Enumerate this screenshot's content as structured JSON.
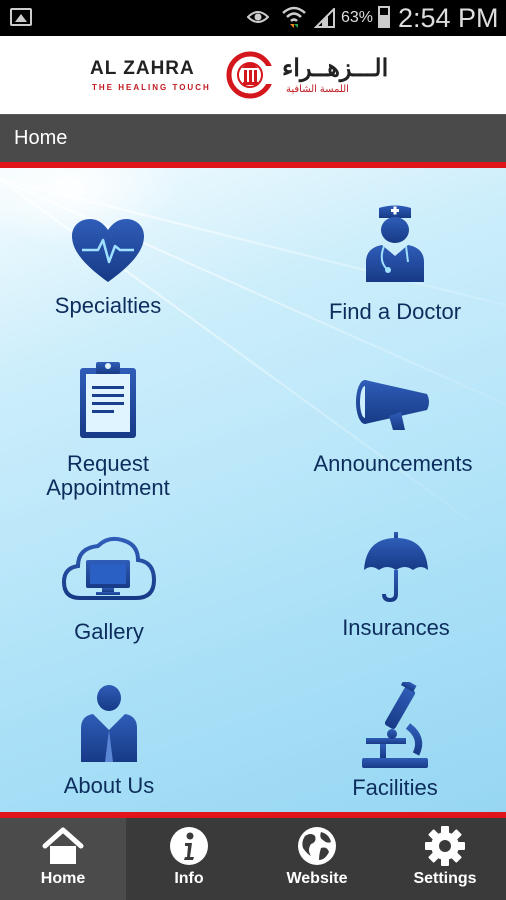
{
  "status_bar": {
    "battery_percent": "63%",
    "time": "2:54 PM"
  },
  "header": {
    "logo_name": "AL ZAHRA",
    "logo_tagline": "THE HEALING TOUCH",
    "logo_name_arabic": "الـــزهــراء",
    "logo_tagline_arabic": "اللمسة الشافية"
  },
  "titlebar": {
    "title": "Home"
  },
  "menu": {
    "specialties": "Specialties",
    "find_doctor": "Find a Doctor",
    "request_line1": "Request",
    "request_line2": "Appointment",
    "announcements": "Announcements",
    "gallery": "Gallery",
    "insurances": "Insurances",
    "about_us": "About Us",
    "facilities": "Facilities"
  },
  "tabs": {
    "home": "Home",
    "info": "Info",
    "website": "Website",
    "settings": "Settings",
    "active": "home"
  },
  "colors": {
    "accent_red": "#e0141b",
    "icon_blue": "#1b3f8f",
    "label_navy": "#0d2d5c",
    "titlebar_gray": "#4a4a4a",
    "tabbar_gray": "#3a3a3a"
  }
}
